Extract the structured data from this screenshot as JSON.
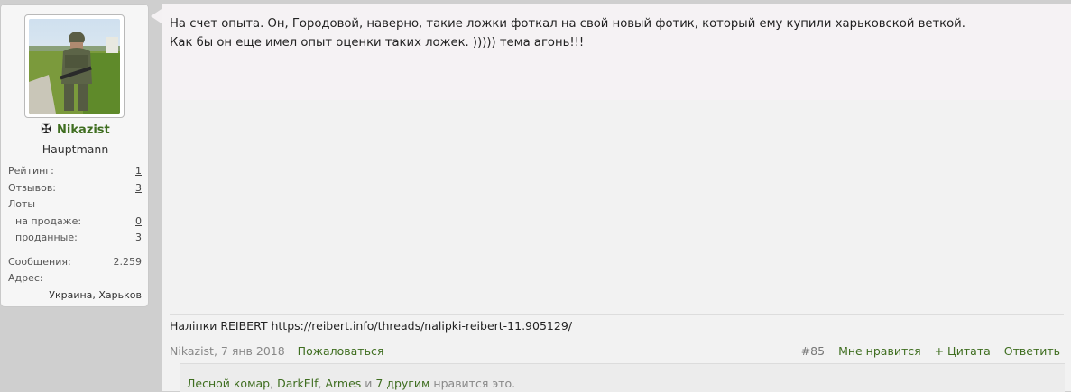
{
  "user": {
    "avatar_icon": "soldier-photo",
    "rank_icon": "iron-cross-icon",
    "name": "Nikazist",
    "title": "Hauptmann",
    "stats": [
      {
        "label": "Рейтинг:",
        "value": "1"
      },
      {
        "label": "Отзывов:",
        "value": "3"
      },
      {
        "label": "Лоты",
        "value": ""
      },
      {
        "label": "на продаже:",
        "value": "0"
      },
      {
        "label": "проданные:",
        "value": "3"
      },
      {
        "label": "Сообщения:",
        "value": "2.259"
      },
      {
        "label": "Адрес:",
        "value": ""
      }
    ],
    "address": "Украина, Харьков"
  },
  "post": {
    "text_line1": "На счет опыта. Он, Городовой, наверно, такие ложки фоткал на свой новый фотик, который ему купили харьковской веткой.",
    "text_line2": "Как бы он еще имел опыт оценки таких ложек. ))))) тема агонь!!!",
    "signature": "Наліпки REIBERT https://reibert.info/threads/nalipki-reibert-11.905129/",
    "author": "Nikazist",
    "date": "7 янв 2018",
    "report_label": "Пожаловаться",
    "post_number": "#85",
    "like_label": "Мне нравится",
    "quote_label": "+ Цитата",
    "reply_label": "Ответить",
    "likes": {
      "user1": "Лесной комар",
      "user2": "DarkElf",
      "user3": "Armes",
      "and": "и",
      "others": "7 другим",
      "suffix": "нравится это."
    }
  },
  "colors": {
    "link_green": "#3f6e20",
    "muted": "#888888"
  }
}
